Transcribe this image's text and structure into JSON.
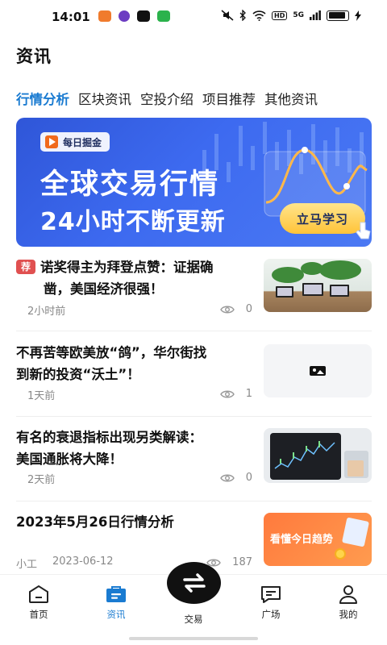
{
  "status_bar": {
    "time": "14:01",
    "network": "5G",
    "hd": "HD"
  },
  "page_title": "资讯",
  "tabs": [
    {
      "label": "行情分析",
      "active": true
    },
    {
      "label": "区块资讯",
      "active": false
    },
    {
      "label": "空投介绍",
      "active": false
    },
    {
      "label": "项目推荐",
      "active": false
    },
    {
      "label": "其他资讯",
      "active": false
    }
  ],
  "banner": {
    "chip": "每日掘金",
    "title": "全球交易行情",
    "subtitle": "24小时不断更新",
    "button": "立马学习"
  },
  "news": [
    {
      "badge": "荐",
      "title_line1": "诺奖得主为拜登点赞：证据确",
      "title_line2": "凿，美国经济很强！",
      "time": "2小时前",
      "views": "0",
      "thumb": "laptop-plants"
    },
    {
      "title_line1": "不再苦等欧美放“鸽”，华尔街找",
      "title_line2": "到新的投资“沃土”！",
      "time": "1天前",
      "views": "1",
      "thumb": "image-placeholder"
    },
    {
      "title_line1": "有名的衰退指标出现另类解读：",
      "title_line2": "美国通胀将大降！",
      "time": "2天前",
      "views": "0",
      "thumb": "tablet-chart"
    },
    {
      "title_line1": "2023年5月26日行情分析",
      "author": "小工",
      "date": "2023-06-12",
      "views": "187",
      "thumb_text": "看懂今日趋势"
    }
  ],
  "bottom_nav": [
    {
      "label": "首页",
      "icon": "home-icon",
      "active": false
    },
    {
      "label": "资讯",
      "icon": "news-icon",
      "active": true
    },
    {
      "label": "交易",
      "icon": "exchange-icon",
      "active": false
    },
    {
      "label": "广场",
      "icon": "chat-icon",
      "active": false
    },
    {
      "label": "我的",
      "icon": "profile-icon",
      "active": false
    }
  ],
  "colors": {
    "accent": "#1a7bd1",
    "banner": "#3d6af0",
    "badge": "#e05050"
  }
}
